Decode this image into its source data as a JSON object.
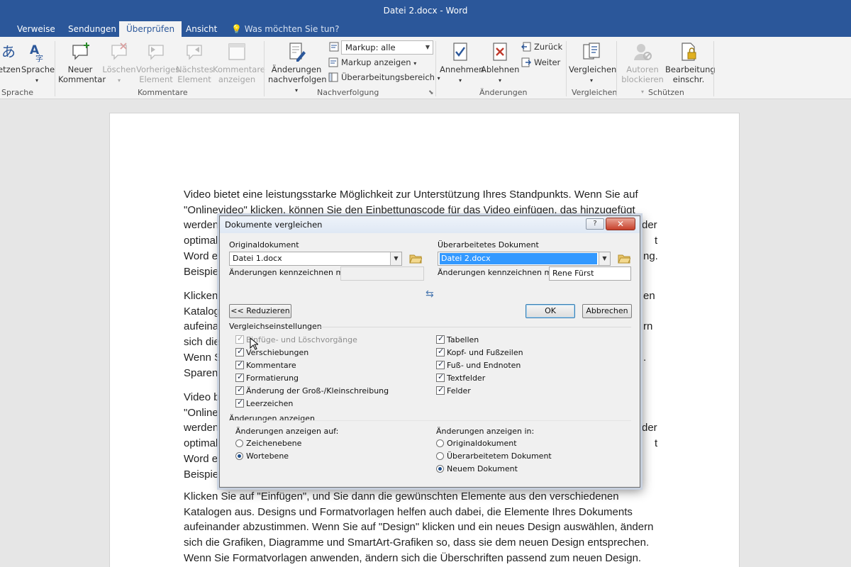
{
  "window": {
    "title": "Datei 2.docx - Word"
  },
  "tabs": [
    {
      "label": "Verweise"
    },
    {
      "label": "Sendungen"
    },
    {
      "label": "Überprüfen"
    },
    {
      "label": "Ansicht"
    }
  ],
  "tell_me": {
    "label": "Was möchten Sie tun?"
  },
  "ribbon": {
    "language": {
      "translate_line1": "etzen",
      "sprache_line1": "Sprache",
      "group": "Sprache"
    },
    "comments": {
      "new_line1": "Neuer",
      "new_line2": "Kommentar",
      "delete_line1": "Löschen",
      "prev_line1": "Vorheriges",
      "prev_line2": "Element",
      "next_line1": "Nächstes",
      "next_line2": "Element",
      "show_line1": "Kommentare",
      "show_line2": "anzeigen",
      "group": "Kommentare"
    },
    "tracking": {
      "track_line1": "Änderungen",
      "track_line2": "nachverfolgen",
      "markup_combo": "Markup: alle",
      "show_markup": "Markup anzeigen",
      "review_pane": "Überarbeitungsbereich",
      "group": "Nachverfolgung"
    },
    "changes": {
      "accept": "Annehmen",
      "reject": "Ablehnen",
      "previous": "Zurück",
      "next": "Weiter",
      "group": "Änderungen"
    },
    "compare": {
      "compare": "Vergleichen",
      "group": "Vergleichen"
    },
    "protect": {
      "block_line1": "Autoren",
      "block_line2": "blockieren",
      "restrict_line1": "Bearbeitung",
      "restrict_line2": "einschr.",
      "group": "Schützen"
    }
  },
  "document": {
    "p1": [
      "Video bietet eine leistungsstarke Möglichkeit zur Unterstützung Ihres Standpunkts. Wenn Sie auf",
      "\"Onlinevideo\" klicken, können Sie den Einbettungscode für das Video einfügen, das hinzugefügt",
      "werden",
      "optimal",
      "Word e",
      "Beispiel"
    ],
    "p1_right": [
      "",
      "",
      "der",
      "t",
      "ng.",
      ""
    ],
    "p2": [
      "Klicken",
      "Katalog",
      "aufeina",
      "sich die",
      "Wenn S",
      "Sparen"
    ],
    "p2_right": [
      "en",
      "",
      "rn",
      "",
      ".",
      ""
    ],
    "p3": [
      "Video b",
      "\"Online",
      "werden",
      "optimal",
      "Word e",
      "Beispiel"
    ],
    "p3_right": [
      "",
      "",
      "der",
      "t",
      "",
      ""
    ],
    "p4": [
      "Klicken Sie auf \"Einfügen\", und Sie dann die gewünschten Elemente aus den verschiedenen",
      "Katalogen aus. Designs und Formatvorlagen helfen auch dabei, die Elemente Ihres Dokuments",
      "aufeinander abzustimmen. Wenn Sie auf \"Design\" klicken und ein neues Design auswählen, ändern",
      "sich die Grafiken, Diagramme und SmartArt-Grafiken so, dass sie dem neuen Design entsprechen.",
      "Wenn Sie Formatvorlagen anwenden, ändern sich die Überschriften passend zum neuen Design."
    ]
  },
  "dialog": {
    "title": "Dokumente vergleichen",
    "help": "?",
    "close": "✕",
    "original_label": "Originaldokument",
    "original_value": "Datei 1.docx",
    "original_mark_label": "Änderungen kennzeichnen mit",
    "original_mark_value": "",
    "revised_label": "Überarbeitetes Dokument",
    "revised_value": "Datei 2.docx",
    "revised_mark_label": "Änderungen kennzeichnen mit",
    "revised_mark_value": "Rene Fürst",
    "reduce_button": "<< Reduzieren",
    "ok_button": "OK",
    "cancel_button": "Abbrechen",
    "settings_header": "Vergleichseinstellungen",
    "settings_left": [
      {
        "label": "Einfüge- und Löschvorgänge",
        "checked": true,
        "disabled": true
      },
      {
        "label": "Verschiebungen",
        "checked": true,
        "disabled": false
      },
      {
        "label": "Kommentare",
        "checked": true,
        "disabled": false
      },
      {
        "label": "Formatierung",
        "checked": true,
        "disabled": false
      },
      {
        "label": "Änderung der Groß-/Kleinschreibung",
        "checked": true,
        "disabled": false
      },
      {
        "label": "Leerzeichen",
        "checked": true,
        "disabled": false
      }
    ],
    "settings_right": [
      {
        "label": "Tabellen",
        "checked": true
      },
      {
        "label": "Kopf- und Fußzeilen",
        "checked": true
      },
      {
        "label": "Fuß- und Endnoten",
        "checked": true
      },
      {
        "label": "Textfelder",
        "checked": true
      },
      {
        "label": "Felder",
        "checked": true
      }
    ],
    "show_header": "Änderungen anzeigen",
    "show_on_label": "Änderungen anzeigen auf:",
    "show_on": [
      {
        "label": "Zeichenebene",
        "selected": false
      },
      {
        "label": "Wortebene",
        "selected": true
      }
    ],
    "show_in_label": "Änderungen anzeigen in:",
    "show_in": [
      {
        "label": "Originaldokument",
        "selected": false
      },
      {
        "label": "Überarbeitetem Dokument",
        "selected": false
      },
      {
        "label": "Neuem Dokument",
        "selected": true
      }
    ]
  },
  "colors": {
    "brand": "#2b579a",
    "selection": "#3399ff"
  }
}
